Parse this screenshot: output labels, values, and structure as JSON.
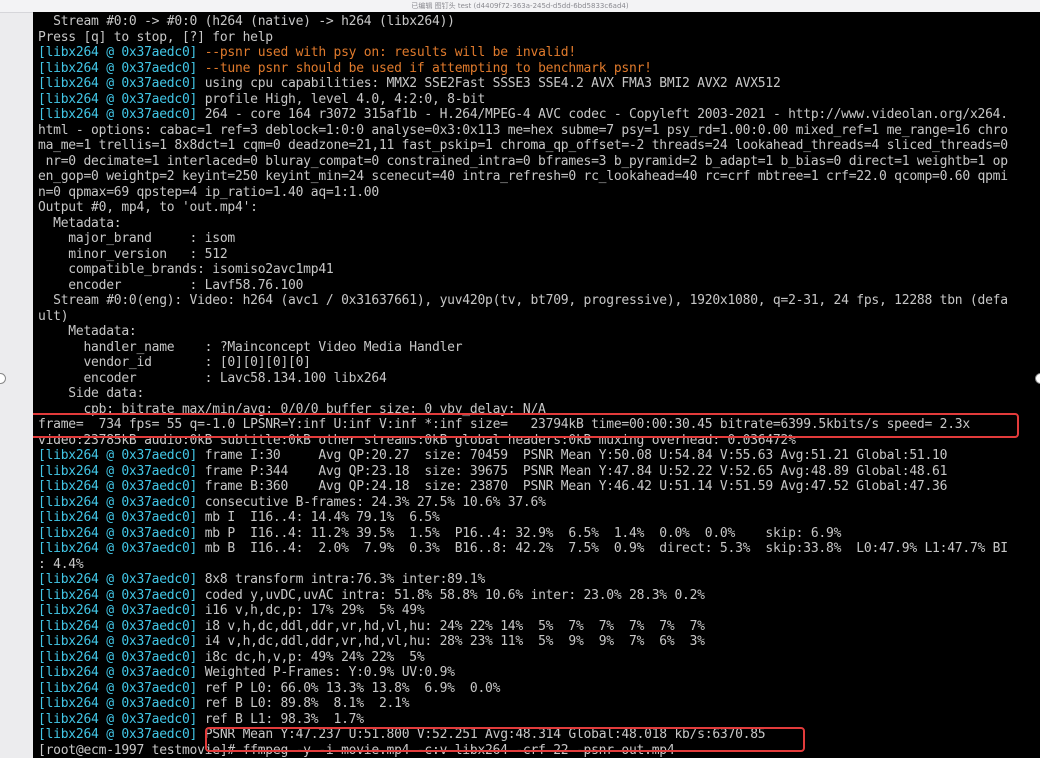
{
  "window": {
    "title": "已编辑 图钉头 test (d4409f72-363a-245d-d5dd-6bd5833c6ad4)"
  },
  "terminal": {
    "prefix": "[libx264 @ 0x37aedc0]",
    "lines": [
      {
        "t": "  Stream #0:0 -> #0:0 (h264 (native) -> h264 (libx264))"
      },
      {
        "t": "Press [q] to stop, [?] for help"
      },
      {
        "p": true,
        "t": " --psnr used with psy on: results will be invalid!",
        "k": "warn"
      },
      {
        "p": true,
        "t": " --tune psnr should be used if attempting to benchmark psnr!",
        "k": "warn"
      },
      {
        "p": true,
        "t": " using cpu capabilities: MMX2 SSE2Fast SSSE3 SSE4.2 AVX FMA3 BMI2 AVX2 AVX512"
      },
      {
        "p": true,
        "t": " profile High, level 4.0, 4:2:0, 8-bit"
      },
      {
        "p": true,
        "t": " 264 - core 164 r3072 315af1b - H.264/MPEG-4 AVC codec - Copyleft 2003-2021 - http://www.videolan.org/x264."
      },
      {
        "t": "html - options: cabac=1 ref=3 deblock=1:0:0 analyse=0x3:0x113 me=hex subme=7 psy=1 psy_rd=1.00:0.00 mixed_ref=1 me_range=16 chro"
      },
      {
        "t": "ma_me=1 trellis=1 8x8dct=1 cqm=0 deadzone=21,11 fast_pskip=1 chroma_qp_offset=-2 threads=24 lookahead_threads=4 sliced_threads=0"
      },
      {
        "t": " nr=0 decimate=1 interlaced=0 bluray_compat=0 constrained_intra=0 bframes=3 b_pyramid=2 b_adapt=1 b_bias=0 direct=1 weightb=1 op"
      },
      {
        "t": "en_gop=0 weightp=2 keyint=250 keyint_min=24 scenecut=40 intra_refresh=0 rc_lookahead=40 rc=crf mbtree=1 crf=22.0 qcomp=0.60 qpmi"
      },
      {
        "t": "n=0 qpmax=69 qpstep=4 ip_ratio=1.40 aq=1:1.00"
      },
      {
        "t": "Output #0, mp4, to 'out.mp4':"
      },
      {
        "t": "  Metadata:"
      },
      {
        "t": "    major_brand     : isom"
      },
      {
        "t": "    minor_version   : 512"
      },
      {
        "t": "    compatible_brands: isomiso2avc1mp41"
      },
      {
        "t": "    encoder         : Lavf58.76.100"
      },
      {
        "t": "  Stream #0:0(eng): Video: h264 (avc1 / 0x31637661), yuv420p(tv, bt709, progressive), 1920x1080, q=2-31, 24 fps, 12288 tbn (defa"
      },
      {
        "t": "ult)"
      },
      {
        "t": "    Metadata:"
      },
      {
        "t": "      handler_name    : ?Mainconcept Video Media Handler"
      },
      {
        "t": "      vendor_id       : [0][0][0][0]"
      },
      {
        "t": "      encoder         : Lavc58.134.100 libx264"
      },
      {
        "t": "    Side data:"
      },
      {
        "t": "      cpb: bitrate max/min/avg: 0/0/0 buffer size: 0 vbv_delay: N/A"
      },
      {
        "t": "frame=  734 fps= 55 q=-1.0 LPSNR=Y:inf U:inf V:inf *:inf size=   23794kB time=00:00:30.45 bitrate=6399.5kbits/s speed= 2.3x"
      },
      {
        "t": "video:23785kB audio:0kB subtitle:0kB other streams:0kB global headers:0kB muxing overhead: 0.036472%"
      },
      {
        "p": true,
        "t": " frame I:30     Avg QP:20.27  size: 70459  PSNR Mean Y:50.08 U:54.84 V:55.63 Avg:51.21 Global:51.10"
      },
      {
        "p": true,
        "t": " frame P:344    Avg QP:23.18  size: 39675  PSNR Mean Y:47.84 U:52.22 V:52.65 Avg:48.89 Global:48.61"
      },
      {
        "p": true,
        "t": " frame B:360    Avg QP:24.18  size: 23870  PSNR Mean Y:46.42 U:51.14 V:51.59 Avg:47.52 Global:47.36"
      },
      {
        "p": true,
        "t": " consecutive B-frames: 24.3% 27.5% 10.6% 37.6%"
      },
      {
        "p": true,
        "t": " mb I  I16..4: 14.4% 79.1%  6.5%"
      },
      {
        "p": true,
        "t": " mb P  I16..4: 11.2% 39.5%  1.5%  P16..4: 32.9%  6.5%  1.4%  0.0%  0.0%    skip: 6.9%"
      },
      {
        "p": true,
        "t": " mb B  I16..4:  2.0%  7.9%  0.3%  B16..8: 42.2%  7.5%  0.9%  direct: 5.3%  skip:33.8%  L0:47.9% L1:47.7% BI"
      },
      {
        "t": ": 4.4%"
      },
      {
        "p": true,
        "t": " 8x8 transform intra:76.3% inter:89.1%"
      },
      {
        "p": true,
        "t": " coded y,uvDC,uvAC intra: 51.8% 58.8% 10.6% inter: 23.0% 28.3% 0.2%"
      },
      {
        "p": true,
        "t": " i16 v,h,dc,p: 17% 29%  5% 49%"
      },
      {
        "p": true,
        "t": " i8 v,h,dc,ddl,ddr,vr,hd,vl,hu: 24% 22% 14%  5%  7%  7%  7%  7%  7%"
      },
      {
        "p": true,
        "t": " i4 v,h,dc,ddl,ddr,vr,hd,vl,hu: 28% 23% 11%  5%  9%  9%  7%  6%  3%"
      },
      {
        "p": true,
        "t": " i8c dc,h,v,p: 49% 24% 22%  5%"
      },
      {
        "p": true,
        "t": " Weighted P-Frames: Y:0.9% UV:0.9%"
      },
      {
        "p": true,
        "t": " ref P L0: 66.0% 13.3% 13.8%  6.9%  0.0%"
      },
      {
        "p": true,
        "t": " ref B L0: 89.8%  8.1%  2.1%"
      },
      {
        "p": true,
        "t": " ref B L1: 98.3%  1.7%"
      },
      {
        "p": true,
        "t": " PSNR Mean Y:47.237 U:51.800 V:52.251 Avg:48.314 Global:48.018 kb/s:6370.85"
      },
      {
        "t": "[root@ecm-1997 testmovie]# ffmpeg -y -i movie.mp4 -c:v libx264 -crf 22 -psnr out.mp4"
      }
    ]
  },
  "annotations": {
    "highlight_color": "#e23b3b",
    "boxes": [
      "progress-line",
      "psnr-summary"
    ]
  }
}
